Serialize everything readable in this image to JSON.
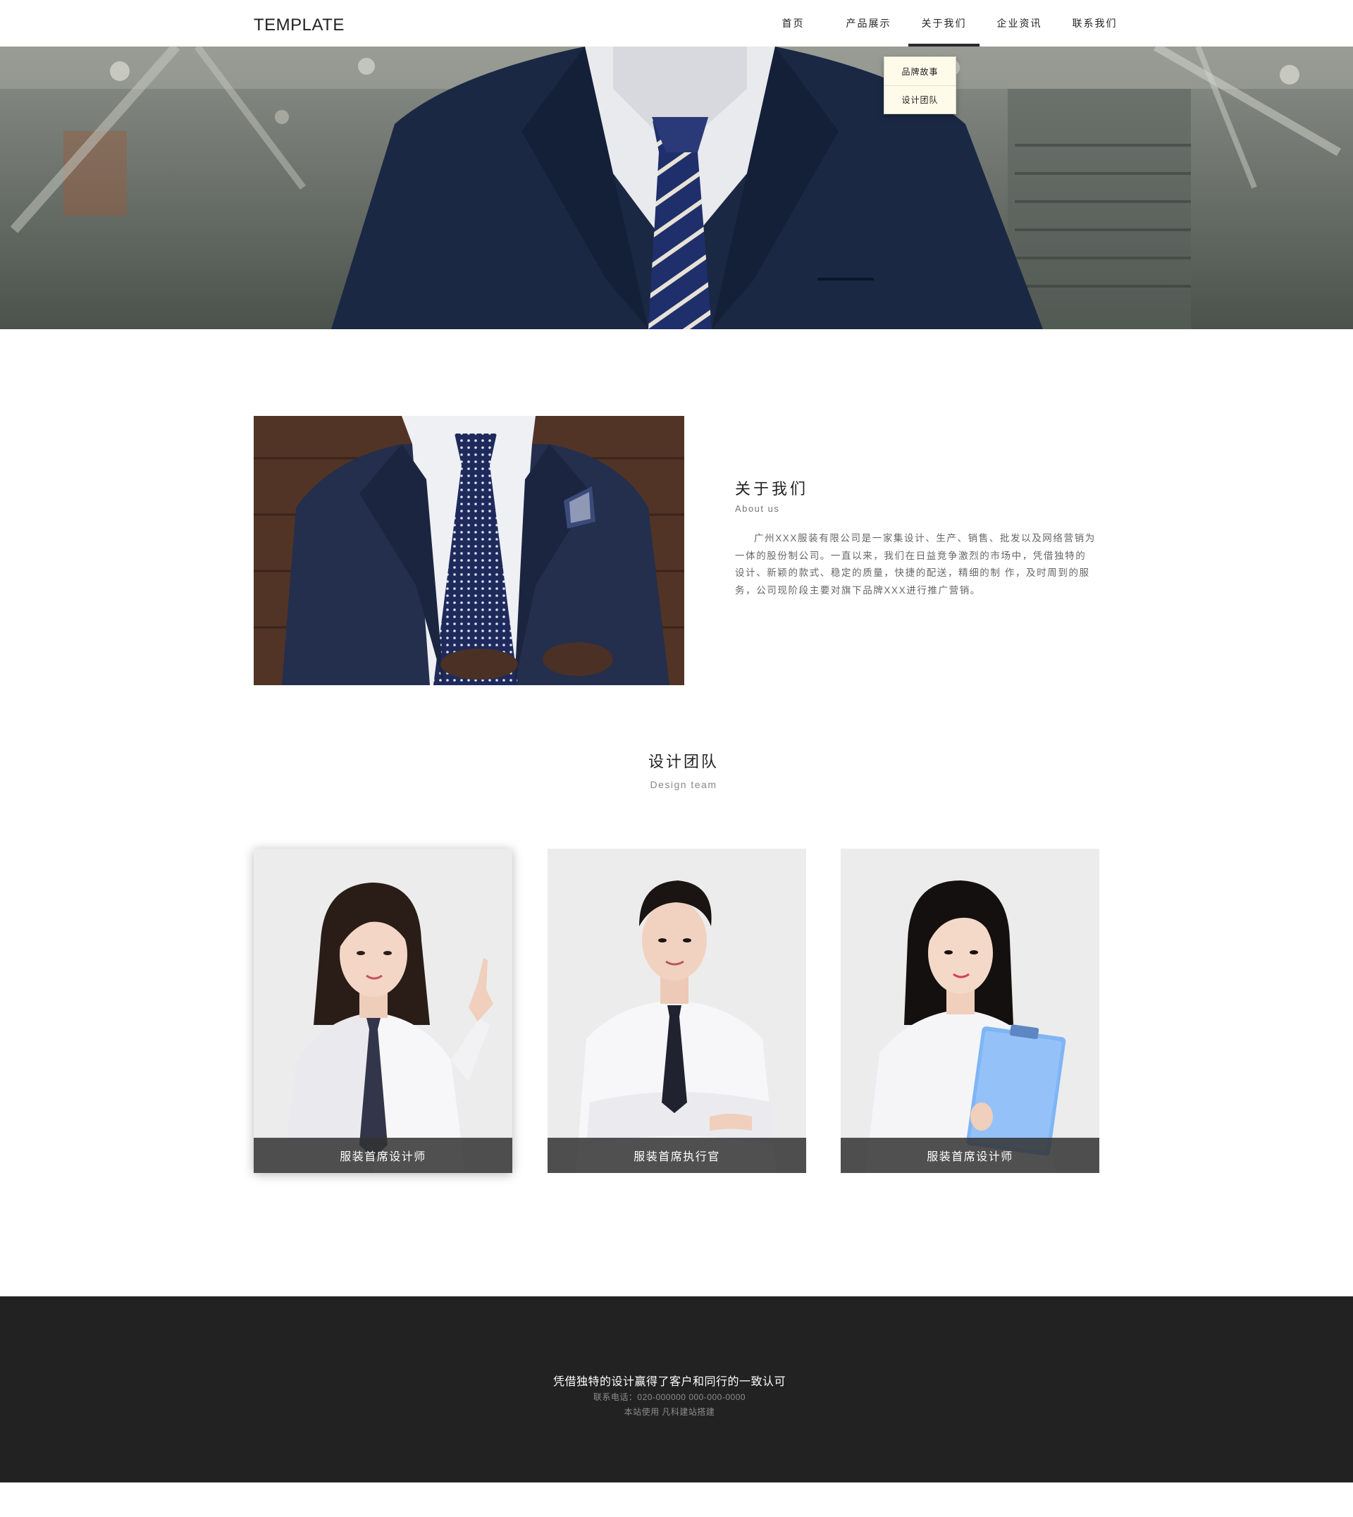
{
  "header": {
    "logo": "TEMPLATE",
    "nav": [
      {
        "label": "首页"
      },
      {
        "label": "产品展示"
      },
      {
        "label": "关于我们",
        "active": true
      },
      {
        "label": "企业资讯"
      },
      {
        "label": "联系我们"
      }
    ],
    "dropdown": [
      "品牌故事",
      "设计团队"
    ]
  },
  "about": {
    "title": "关于我们",
    "subtitle": "About us",
    "text": "广州XXX服装有限公司是一家集设计、生产、销售、批发以及网络营销为一体的股份制公司。一直以来，我们在日益竞争激烈的市场中，凭借独特的设计、新颖的款式、稳定的质量，快捷的配送，精细的制 作，及时周到的服务，公司现阶段主要对旗下品牌XXX进行推广营销。"
  },
  "team": {
    "title": "设计团队",
    "subtitle": "Design team",
    "members": [
      {
        "role": "服装首席设计师"
      },
      {
        "role": "服装首席执行官"
      },
      {
        "role": "服装首席设计师"
      }
    ]
  },
  "footer": {
    "slogan": "凭借独特的设计赢得了客户和同行的一致认可",
    "contact": "联系电话：020-000000   000-000-0000",
    "credit": "本站使用   凡科建站搭建"
  },
  "colors": {
    "footer_bg": "#222222",
    "dropdown_bg": "#fffbea",
    "caption_bg": "#323232",
    "card_bg": "#ececec"
  }
}
